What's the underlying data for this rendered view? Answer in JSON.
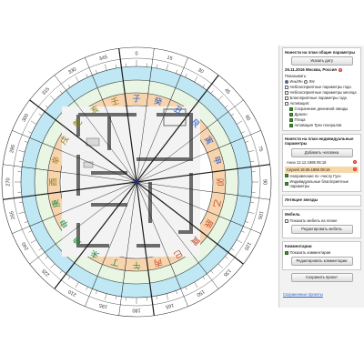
{
  "compass": {
    "degree_labels": [
      "0",
      "15",
      "30",
      "45",
      "60",
      "75",
      "90",
      "105",
      "120",
      "135",
      "150",
      "165",
      "180",
      "195",
      "210",
      "225",
      "240",
      "255",
      "270",
      "285",
      "300",
      "315",
      "330",
      "345"
    ],
    "mountains": [
      "子",
      "癸",
      "丑",
      "艮",
      "寅",
      "甲",
      "卯",
      "乙",
      "辰",
      "巽",
      "巳",
      "丙",
      "午",
      "丁",
      "未",
      "坤",
      "申",
      "庚",
      "酉",
      "辛",
      "戌",
      "乾",
      "亥",
      "壬"
    ],
    "colors": {
      "outer_ring": "#ffffff",
      "blue_ring": "#bfe8f4",
      "green_ring": "#e8f6e3",
      "orange_ring": "#f7d4ae",
      "mountain_ring": "#ffffff",
      "wall": "#6b6b6b",
      "line": "#1a1a1a",
      "center": "#1b2b9a"
    }
  },
  "panel": {
    "common": {
      "title": "Нанести на план общие параметры",
      "add_date_label": "Указать дату",
      "date": "26.11.2016 Москва, Россия",
      "show_label": "Показывать:",
      "period_radio": "Инь/Ян",
      "period_option": "Ляг",
      "options": [
        {
          "label": "Неблагоприятные параметры года",
          "checked": false
        },
        {
          "label": "Неблагоприятные параметры месяца",
          "checked": false
        },
        {
          "label": "Благоприятные параметры года",
          "checked": false
        },
        {
          "label": "Активация:",
          "checked": false
        }
      ],
      "activations": [
        {
          "label": "Сохранение денежной звезды",
          "checked": true
        },
        {
          "label": "Дракон",
          "checked": true
        },
        {
          "label": "Птица",
          "checked": true
        },
        {
          "label": "Активация Трех генералов",
          "checked": true
        }
      ]
    },
    "individual": {
      "title": "Нанести на план индивидуальные параметры",
      "add_person_label": "Добавить человека",
      "people": [
        {
          "label": "Анна 12.12.1985 05:16",
          "bg": "#ffffff"
        },
        {
          "label": "Сергей 19.05.1986 09:16",
          "bg": "#f7d8a8"
        }
      ],
      "options": [
        {
          "label": "Направление по «числу Гуа»",
          "checked": true
        },
        {
          "label": "Индивидуальные благоприятные параметры",
          "checked": true
        }
      ]
    },
    "stars": {
      "title": "Летящие звезды"
    },
    "furniture": {
      "title": "Мебель",
      "show_label": "Показать мебель на плане",
      "edit_label": "Редактировать мебель"
    },
    "comments": {
      "title": "Комментарии",
      "show_label": "Показать комментарии",
      "edit_label": "Редактировать комментарии"
    },
    "save_label": "Сохранить проект",
    "footer_link": "Сохраненные проекты"
  }
}
